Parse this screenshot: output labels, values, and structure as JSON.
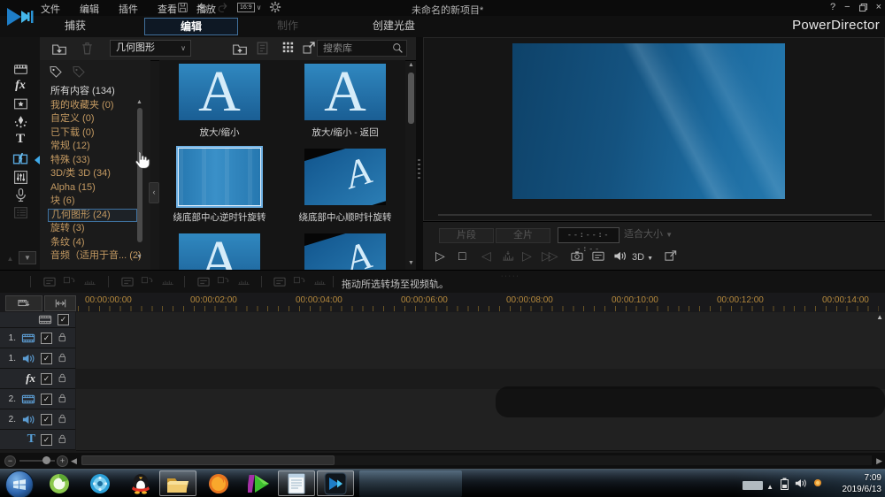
{
  "titlebar": {
    "menus": [
      "文件",
      "编辑",
      "插件",
      "查看",
      "播放"
    ],
    "project_title": "未命名的新项目*",
    "aspect_ratio": "16:9",
    "window_controls": {
      "help": "?",
      "minimize": "−",
      "close": "×"
    }
  },
  "brand": "PowerDirector",
  "mode_tabs": [
    {
      "id": "capture",
      "label": "捕获",
      "state": "normal"
    },
    {
      "id": "edit",
      "label": "编辑",
      "state": "active"
    },
    {
      "id": "produce",
      "label": "制作",
      "state": "disabled"
    },
    {
      "id": "create-disc",
      "label": "创建光盘",
      "state": "normal"
    }
  ],
  "rooms": [
    {
      "id": "media-room",
      "active": false,
      "disabled": false
    },
    {
      "id": "effects-room",
      "active": false,
      "disabled": false
    },
    {
      "id": "pip-objects-room",
      "active": false,
      "disabled": false
    },
    {
      "id": "particle-room",
      "active": false,
      "disabled": false
    },
    {
      "id": "title-room",
      "active": false,
      "disabled": false
    },
    {
      "id": "transition-room",
      "active": true,
      "disabled": false
    },
    {
      "id": "audio-mixing-room",
      "active": false,
      "disabled": false
    },
    {
      "id": "voiceover-room",
      "active": false,
      "disabled": false
    },
    {
      "id": "chapter-room",
      "active": false,
      "disabled": true
    }
  ],
  "library": {
    "filter_value": "几何图形",
    "search_placeholder": "搜索库",
    "categories": [
      {
        "label": "所有内容 (134)",
        "tone": "plain",
        "selected": false
      },
      {
        "label": "我的收藏夹 (0)",
        "tone": "tan",
        "selected": false
      },
      {
        "label": "自定义 (0)",
        "tone": "tan",
        "selected": false
      },
      {
        "label": "已下载 (0)",
        "tone": "tan",
        "selected": false
      },
      {
        "label": "常规 (12)",
        "tone": "tan",
        "selected": false
      },
      {
        "label": "特殊 (33)",
        "tone": "tan",
        "selected": false
      },
      {
        "label": "3D/类 3D (34)",
        "tone": "tan",
        "selected": false
      },
      {
        "label": "Alpha (15)",
        "tone": "tan",
        "selected": false
      },
      {
        "label": "块 (6)",
        "tone": "tan",
        "selected": false
      },
      {
        "label": "几何图形 (24)",
        "tone": "tan",
        "selected": true
      },
      {
        "label": "旋转 (3)",
        "tone": "tan",
        "selected": false
      },
      {
        "label": "条纹 (4)",
        "tone": "tan",
        "selected": false
      },
      {
        "label": "音频（适用于音... (2)",
        "tone": "tan",
        "selected": false
      }
    ],
    "items": [
      {
        "caption": "放大/缩小",
        "variant": "letter",
        "selected": false
      },
      {
        "caption": "放大/缩小 - 返回",
        "variant": "letter",
        "selected": false
      },
      {
        "caption": "绕底部中心逆时针旋转",
        "variant": "plain",
        "selected": true
      },
      {
        "caption": "绕底部中心顺时针旋转",
        "variant": "tilted",
        "selected": false
      },
      {
        "caption": "",
        "variant": "letter",
        "selected": false
      },
      {
        "caption": "",
        "variant": "tilted",
        "selected": false
      }
    ]
  },
  "preview": {
    "clip_button": "片段",
    "movie_button": "全片",
    "timecode": "--:--:--:--",
    "fit_select": "适合大小",
    "threed_label": "3D"
  },
  "action_hint": "拖动所选转场至视频轨。",
  "timeline": {
    "ruler": [
      "00:00:00:00",
      "00:00:02:00",
      "00:00:04:00",
      "00:00:06:00",
      "00:00:08:00",
      "00:00:10:00",
      "00:00:12:00",
      "00:00:14:00"
    ],
    "tracks": [
      {
        "label": "",
        "type": "video",
        "partial": true,
        "lock": false
      },
      {
        "label": "1.",
        "type": "video",
        "partial": false,
        "lock": true
      },
      {
        "label": "1.",
        "type": "audio",
        "partial": false,
        "lock": true
      },
      {
        "label": "fx",
        "type": "effect",
        "partial": false,
        "lock": true
      },
      {
        "label": "2.",
        "type": "video",
        "partial": false,
        "lock": true
      },
      {
        "label": "2.",
        "type": "audio",
        "partial": false,
        "lock": true
      },
      {
        "label": "T",
        "type": "title",
        "partial": false,
        "lock": true
      }
    ]
  },
  "taskbar": {
    "apps": [
      {
        "id": "browser-360",
        "active": false
      },
      {
        "id": "media-player",
        "active": false
      },
      {
        "id": "qq",
        "active": false
      },
      {
        "id": "file-explorer",
        "active": true
      },
      {
        "id": "firefox",
        "active": false
      },
      {
        "id": "video-player",
        "active": false
      },
      {
        "id": "notepad",
        "active": true
      },
      {
        "id": "powerdirector",
        "active": true
      }
    ],
    "time": "7:09",
    "date": "2019/6/13"
  },
  "colors": {
    "accent": "#4a90c8",
    "category_text": "#c49a62",
    "ruler_text": "#b5893c",
    "active_room": "#58a6dc"
  }
}
